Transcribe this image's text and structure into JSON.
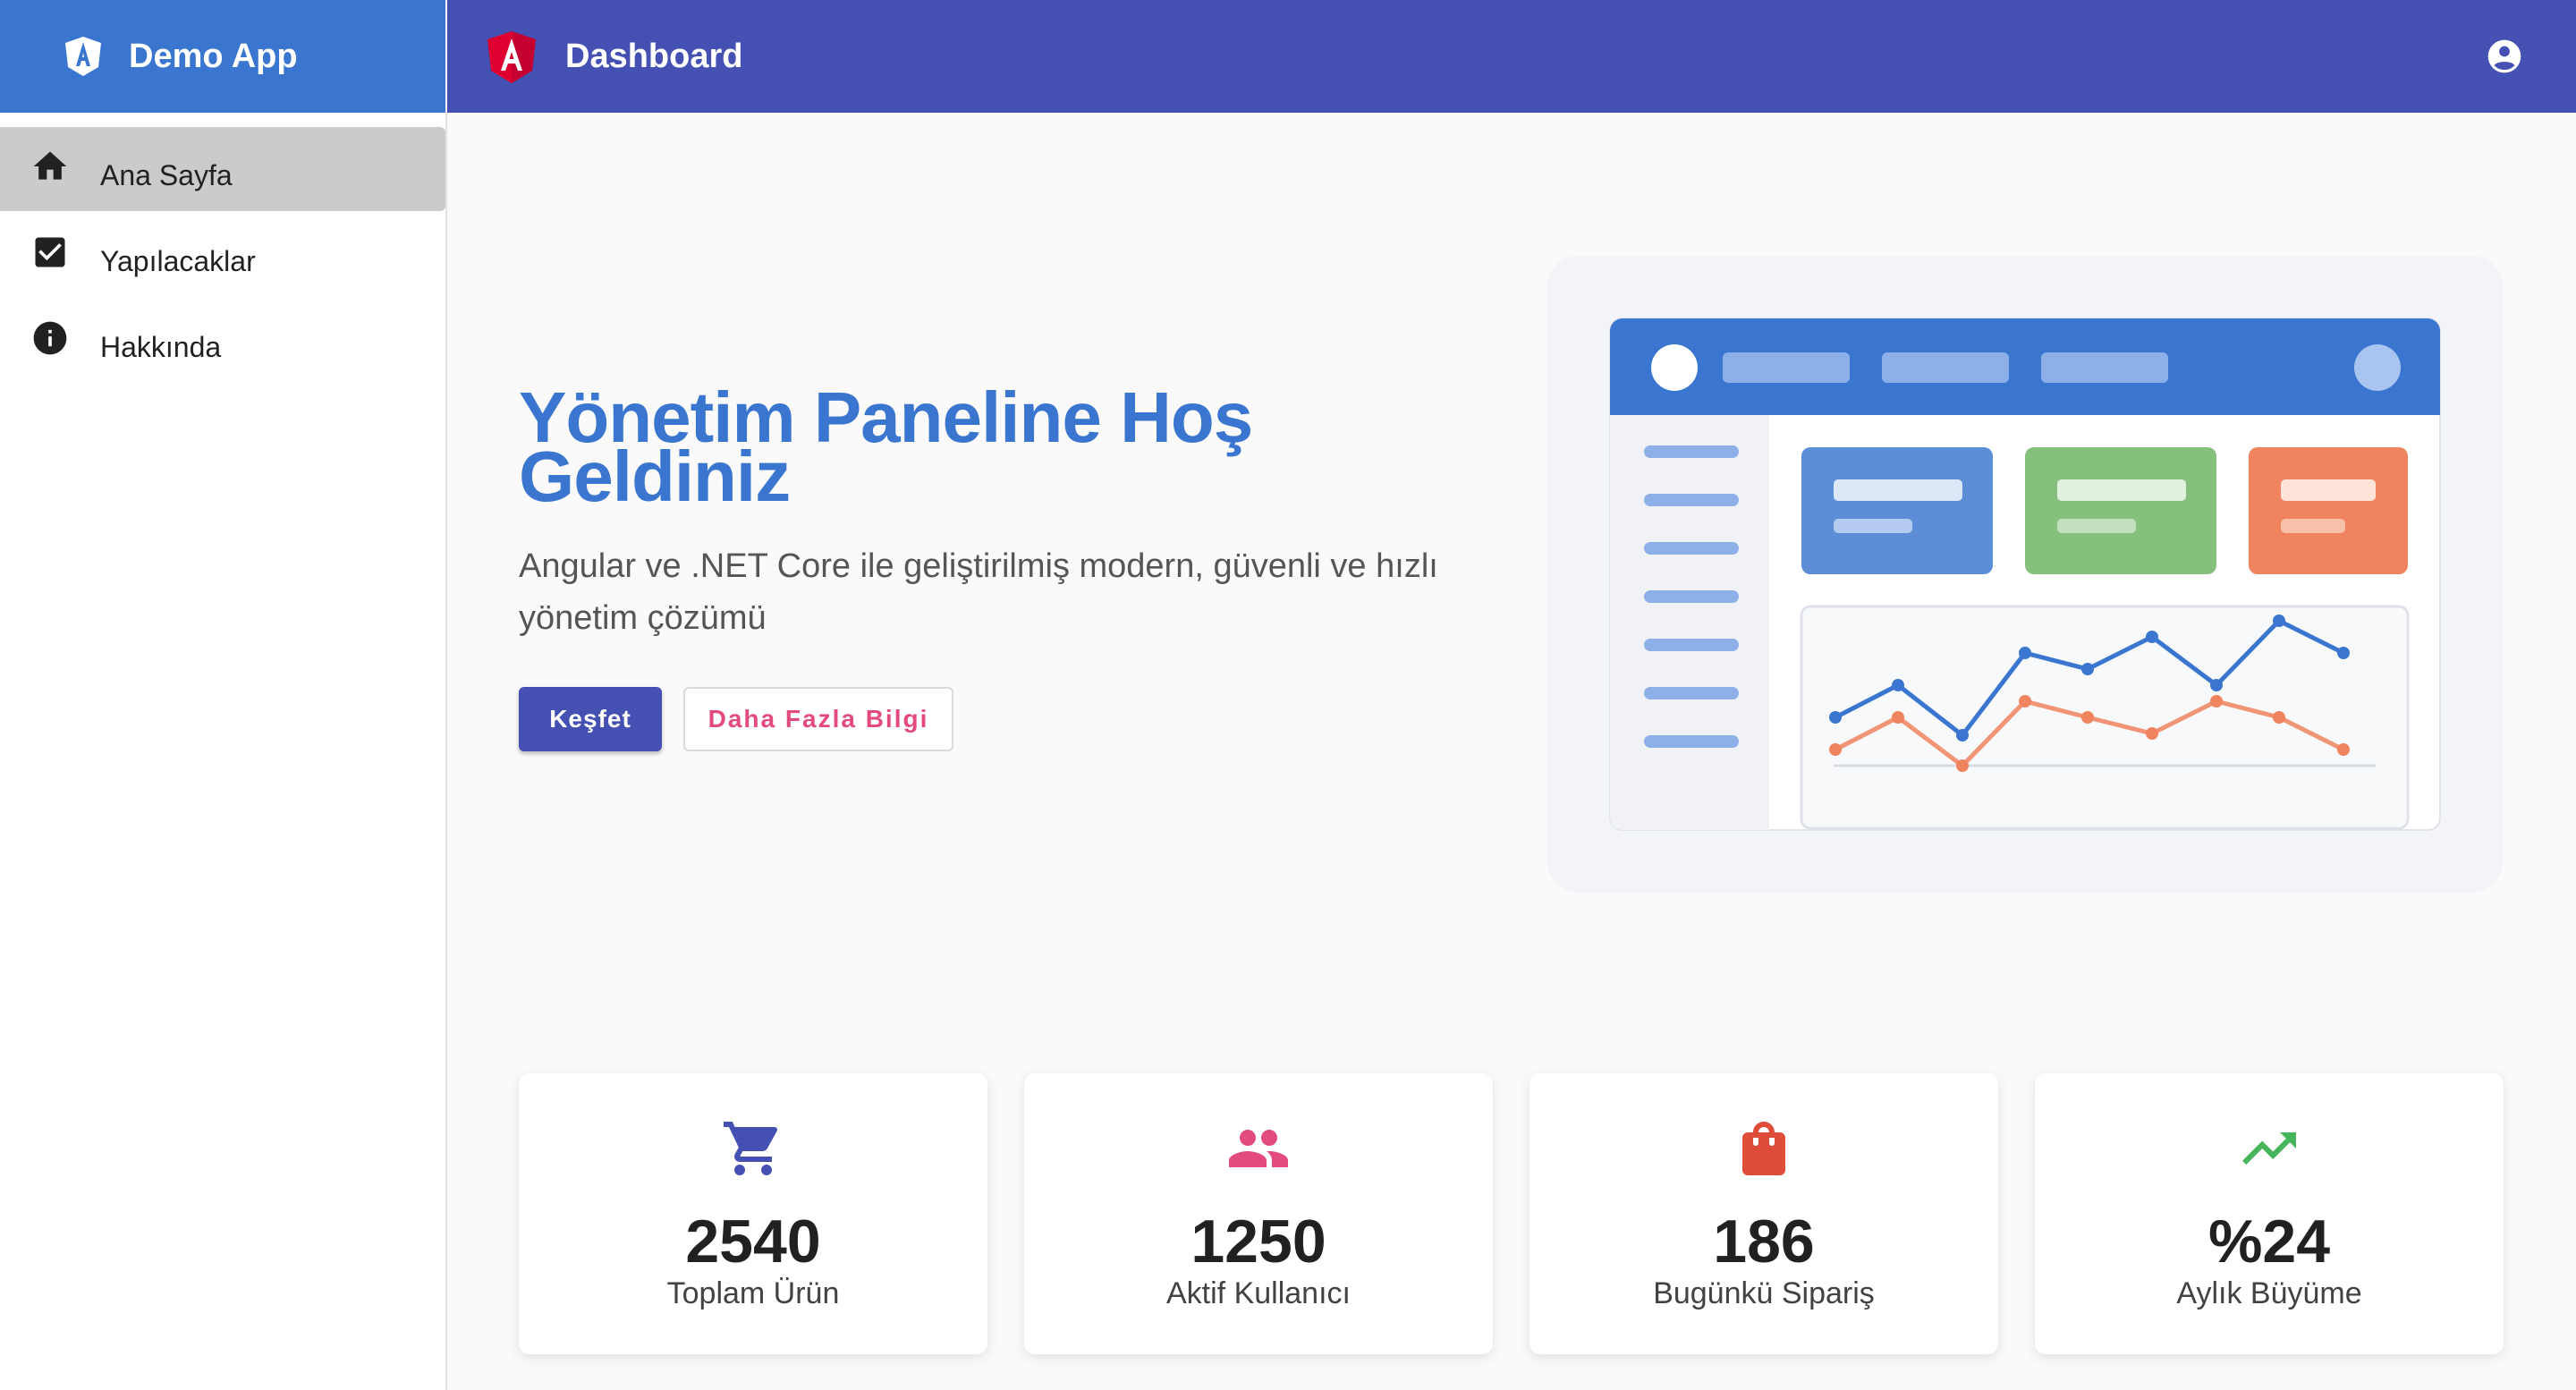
{
  "app": {
    "brand": "Demo App",
    "page_title": "Dashboard"
  },
  "sidebar": {
    "items": [
      {
        "label": "Ana Sayfa",
        "icon": "home-icon",
        "active": true
      },
      {
        "label": "Yapılacaklar",
        "icon": "checkbox-icon",
        "active": false
      },
      {
        "label": "Hakkında",
        "icon": "info-icon",
        "active": false
      }
    ]
  },
  "hero": {
    "title": "Yönetim Paneline Hoş Geldiniz",
    "subtitle": "Angular ve .NET Core ile geliştirilmiş modern, güvenli ve hızlı yönetim çözümü",
    "primary_button": "Keşfet",
    "secondary_button": "Daha Fazla Bilgi"
  },
  "stats": [
    {
      "value": "2540",
      "label": "Toplam Ürün",
      "icon": "cart-icon",
      "color": "#4550b3"
    },
    {
      "value": "1250",
      "label": "Aktif Kullanıcı",
      "icon": "people-icon",
      "color": "#e34a7d"
    },
    {
      "value": "186",
      "label": "Bugünkü Sipariş",
      "icon": "shopping-bag-icon",
      "color": "#e04c3a"
    },
    {
      "value": "%24",
      "label": "Aylık Büyüme",
      "icon": "trending-up-icon",
      "color": "#45b45a"
    }
  ],
  "colors": {
    "primary": "#4550b3",
    "brand_blue": "#3a76d0",
    "accent_pink": "#e34a7d",
    "illustration_blue": "#5b8ed6",
    "illustration_green": "#86c07d",
    "illustration_orange": "#f0845e"
  }
}
